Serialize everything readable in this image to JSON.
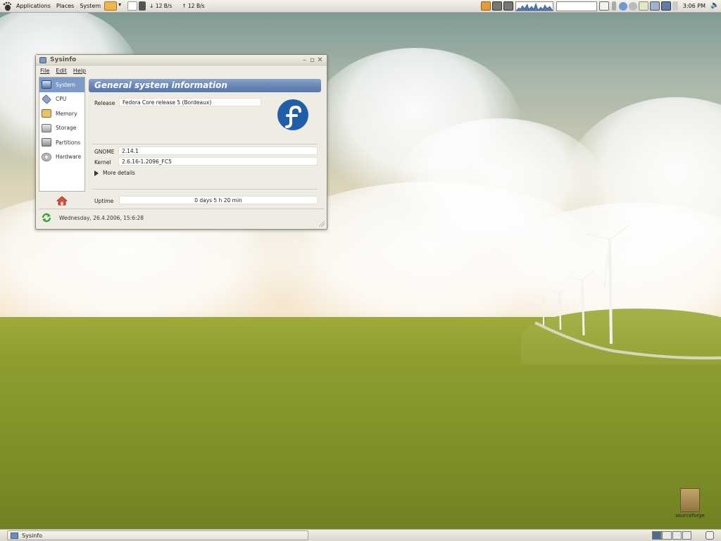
{
  "top_panel": {
    "menus": [
      "Applications",
      "Places",
      "System"
    ],
    "down_rate": "12 B/s",
    "up_rate": "12 B/s",
    "clock": "3:06 PM"
  },
  "window": {
    "title": "Sysinfo",
    "menu": {
      "file": "File",
      "edit": "Edit",
      "help": "Help"
    },
    "sidebar": [
      {
        "label": "System",
        "icon": "monitor-icon",
        "selected": true
      },
      {
        "label": "CPU",
        "icon": "cpu-icon"
      },
      {
        "label": "Memory",
        "icon": "memory-icon"
      },
      {
        "label": "Storage",
        "icon": "storage-icon"
      },
      {
        "label": "Partitions",
        "icon": "partitions-icon"
      },
      {
        "label": "Hardware",
        "icon": "hardware-icon"
      }
    ],
    "header": "General system information",
    "release_label": "Release",
    "release_value": "Fedora Core release 5 (Bordeaux)",
    "gnome_label": "GNOME",
    "gnome_value": "2.14.1",
    "kernel_label": "Kernel",
    "kernel_value": "2.6.16-1.2096_FC5",
    "more_details": "More details",
    "uptime_label": "Uptime",
    "uptime_value": "0 days 5 h 20 min",
    "status": "Wednesday, 26.4.2006, 15:6:28"
  },
  "desktop": {
    "icon_label": "sourceforge"
  },
  "bottom_panel": {
    "task_label": "Sysinfo"
  },
  "colors": {
    "selection": "#7d9bc9",
    "header_band": "#6383b3"
  }
}
